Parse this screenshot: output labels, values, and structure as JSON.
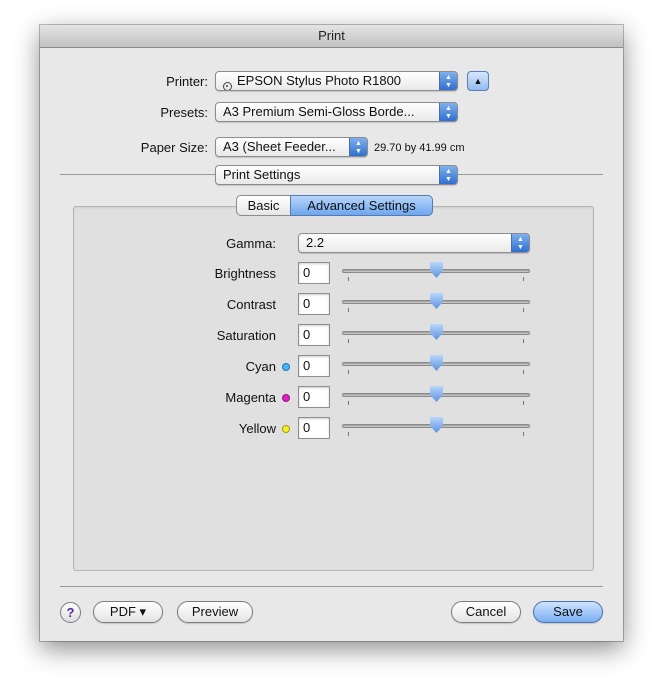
{
  "window": {
    "title": "Print"
  },
  "printer": {
    "label": "Printer:",
    "value": "EPSON Stylus Photo R1800"
  },
  "presets": {
    "label": "Presets:",
    "value": "A3 Premium Semi-Gloss Borde..."
  },
  "paper_size": {
    "label": "Paper Size:",
    "value": "A3 (Sheet Feeder...",
    "dimensions": "29.70 by 41.99 cm"
  },
  "panel_select": {
    "value": "Print Settings"
  },
  "tabs": [
    {
      "label": "Basic",
      "selected": false
    },
    {
      "label": "Advanced Settings",
      "selected": true
    }
  ],
  "gamma": {
    "label": "Gamma:",
    "value": "2.2"
  },
  "adjustments": [
    {
      "label": "Brightness",
      "value": "0",
      "slider_position": 0.5
    },
    {
      "label": "Contrast",
      "value": "0",
      "slider_position": 0.5
    },
    {
      "label": "Saturation",
      "value": "0",
      "slider_position": 0.5
    },
    {
      "label": "Cyan",
      "value": "0",
      "slider_position": 0.5,
      "dot_color": "#3fb8ff"
    },
    {
      "label": "Magenta",
      "value": "0",
      "slider_position": 0.5,
      "dot_color": "#e020c0"
    },
    {
      "label": "Yellow",
      "value": "0",
      "slider_position": 0.5,
      "dot_color": "#f2f020"
    }
  ],
  "buttons": {
    "help": "?",
    "pdf": "PDF ▾",
    "preview": "Preview",
    "cancel": "Cancel",
    "save": "Save"
  },
  "colors": {
    "accent": "#6ea6ee",
    "window_bg": "#e8e8e8"
  }
}
